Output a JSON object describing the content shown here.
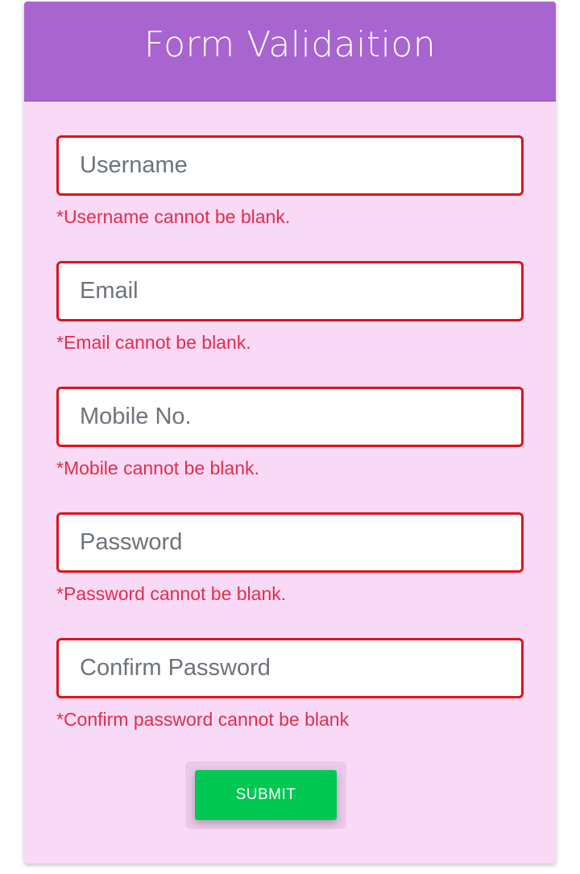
{
  "header": {
    "title": "Form Validaition",
    "background": "#a864cf"
  },
  "form": {
    "background": "#f8daf6",
    "error_color": "#e32d4a",
    "input_border_color": "#e0121a",
    "fields": [
      {
        "placeholder": "Username",
        "value": "",
        "error": "*Username cannot be blank."
      },
      {
        "placeholder": "Email",
        "value": "",
        "error": "*Email cannot be blank."
      },
      {
        "placeholder": "Mobile No.",
        "value": "",
        "error": "*Mobile cannot be blank."
      },
      {
        "placeholder": "Password",
        "value": "",
        "error": "*Password cannot be blank."
      },
      {
        "placeholder": "Confirm Password",
        "value": "",
        "error": "*Confirm password cannot be blank"
      }
    ],
    "submit_label": "SUBMIT",
    "submit_color": "#00c853"
  }
}
